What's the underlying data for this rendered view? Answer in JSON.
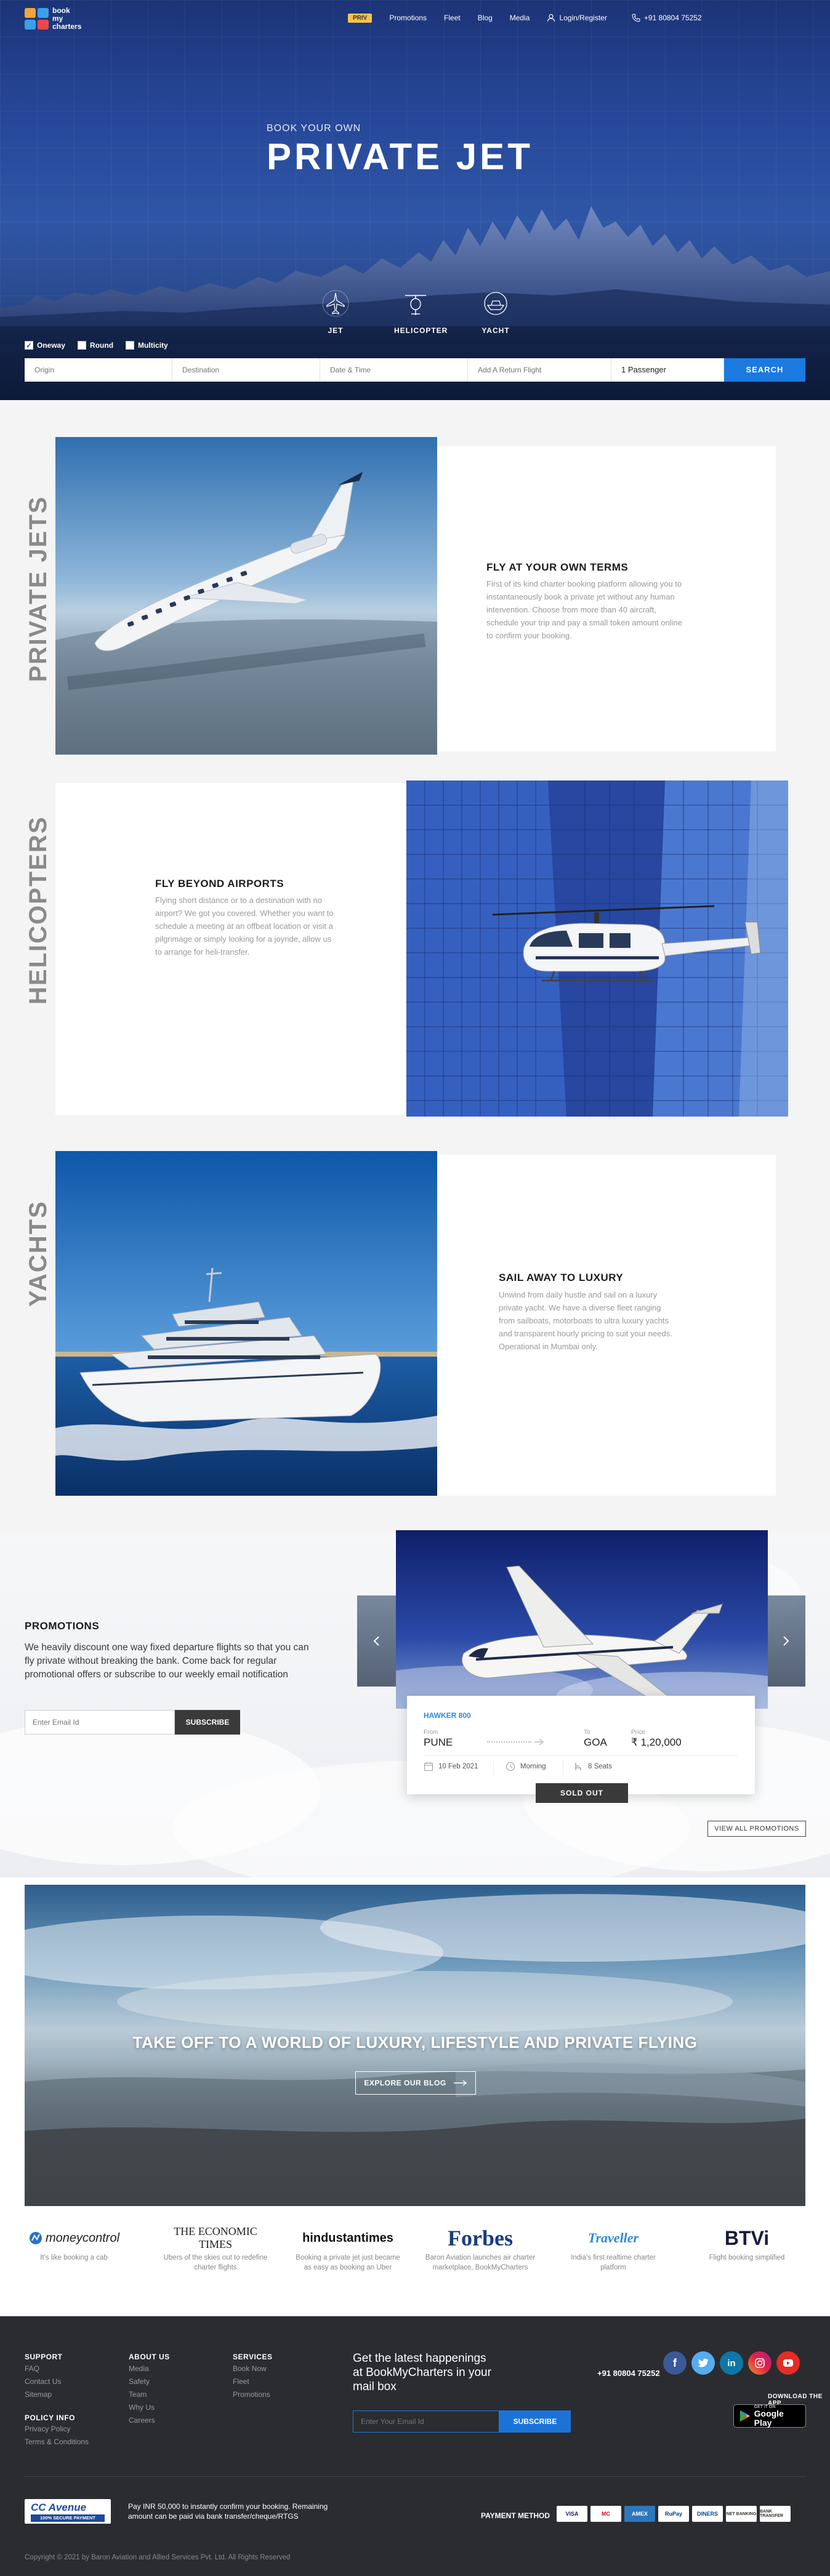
{
  "brand": {
    "logo_line1": "book",
    "logo_line2": "my",
    "logo_line3": "charters"
  },
  "nav": {
    "priv": "PRIV",
    "items": [
      "Promotions",
      "Fleet",
      "Blog",
      "Media"
    ],
    "login": "Login/Register",
    "phone": "+91 80804 75252"
  },
  "hero": {
    "subtitle": "BOOK YOUR OWN",
    "title": "PRIVATE JET",
    "modes": [
      {
        "label": "JET",
        "icon": "jet-icon"
      },
      {
        "label": "HELICOPTER",
        "icon": "helicopter-icon"
      },
      {
        "label": "YACHT",
        "icon": "yacht-icon"
      }
    ]
  },
  "search": {
    "trip_types": [
      {
        "label": "Oneway",
        "checked": true
      },
      {
        "label": "Round",
        "checked": false
      },
      {
        "label": "Multicity",
        "checked": false
      }
    ],
    "origin_placeholder": "Origin",
    "destination_placeholder": "Destination",
    "date_placeholder": "Date & Time",
    "return_placeholder": "Add A Return Flight",
    "passengers": "1 Passenger",
    "button": "SEARCH"
  },
  "services": [
    {
      "side_label": "PRIVATE JETS",
      "title": "FLY AT YOUR OWN TERMS",
      "text": "First of its kind charter booking platform allowing you to instantaneously book a private jet without any human intervention. Choose from more than 40 aircraft, schedule your trip and pay a small token amount online to confirm your booking."
    },
    {
      "side_label": "HELICOPTERS",
      "title": "FLY BEYOND AIRPORTS",
      "text": "Flying short distance or to a destination with no airport? We got you covered. Whether you want to schedule a meeting at an offbeat location or visit a pilgrimage or simply looking for a joyride, allow us to arrange for heli-transfer."
    },
    {
      "side_label": "YACHTS",
      "title": "SAIL AWAY TO LUXURY",
      "text": "Unwind from daily hustle and sail on a luxury private yacht. We have a diverse fleet ranging from sailboats, motorboats to ultra luxury yachts and transparent hourly pricing to suit your needs. Operational in Mumbai only."
    }
  ],
  "promotions": {
    "title": "PROMOTIONS",
    "text": "We heavily discount one way fixed departure flights so that you can fly private without breaking the bank. Come back for regular promotional offers or subscribe to our weekly email notification",
    "email_placeholder": "Enter Email Id",
    "subscribe": "SUBSCRIBE",
    "deal": {
      "aircraft": "HAWKER 800",
      "from_label": "From",
      "from": "PUNE",
      "to_label": "To",
      "to": "GOA",
      "price_label": "Price",
      "price": "₹ 1,20,000",
      "date": "10 Feb 2021",
      "time": "Morning",
      "seats": "8 Seats",
      "status": "SOLD OUT"
    },
    "view_all": "VIEW ALL PROMOTIONS"
  },
  "banner": {
    "title": "TAKE OFF TO A WORLD OF LUXURY, LIFESTYLE AND PRIVATE FLYING",
    "button": "EXPLORE OUR BLOG"
  },
  "press": [
    {
      "name": "moneycontrol",
      "caption": "It's like booking a cab"
    },
    {
      "name": "THE ECONOMIC TIMES",
      "caption": "Ubers of the skies out to redefine charter flights"
    },
    {
      "name": "hindustantimes",
      "caption": "Booking a private jet just became as easy as booking an Uber"
    },
    {
      "name": "Forbes",
      "caption": "Baron Aviation launches air charter marketplace, BookMyCharters"
    },
    {
      "name": "Traveller",
      "caption": "India's first realtime charter platform"
    },
    {
      "name": "BTVi",
      "caption": "Flight booking simplified"
    }
  ],
  "footer": {
    "support": {
      "title": "SUPPORT",
      "links": [
        "FAQ",
        "Contact Us",
        "Sitemap"
      ]
    },
    "policy": {
      "title": "POLICY INFO",
      "links": [
        "Privacy Policy",
        "Terms & Conditions"
      ]
    },
    "about": {
      "title": "ABOUT US",
      "links": [
        "Media",
        "Safety",
        "Team",
        "Why Us",
        "Careers"
      ]
    },
    "services": {
      "title": "SERVICES",
      "links": [
        "Book Now",
        "Fleet",
        "Promotions"
      ]
    },
    "newsletter_title": "Get the latest happenings at BookMyCharters in your mail box",
    "newsletter_placeholder": "Enter Your Email Id",
    "newsletter_button": "SUBSCRIBE",
    "phone": "+91 80804 75252",
    "download": "DOWNLOAD THE APP",
    "getiton": "GET IT ON",
    "googleplay": "Google Play",
    "ccavenue": "CC Avenue",
    "ccavenue_sub": "100% SECURE PAYMENT",
    "pay_text": "Pay INR 50,000 to instantly confirm your booking. Remaining amount can be paid via bank transfer/cheque/RTGS",
    "payment_method": "PAYMENT METHOD",
    "cards": [
      "VISA",
      "MC",
      "AMEX",
      "RuPay",
      "DINERS",
      "NET BANKING",
      "BANK TRANSFER"
    ],
    "copyright": "Copyright © 2021 by Baron Aviation and Allied Services Pvt. Ltd. All Rights Reserved"
  },
  "colors": {
    "accent": "#1a7ae0",
    "priv": "#f3c24a",
    "hero": "#27489a",
    "footer": "#2b2c30"
  }
}
